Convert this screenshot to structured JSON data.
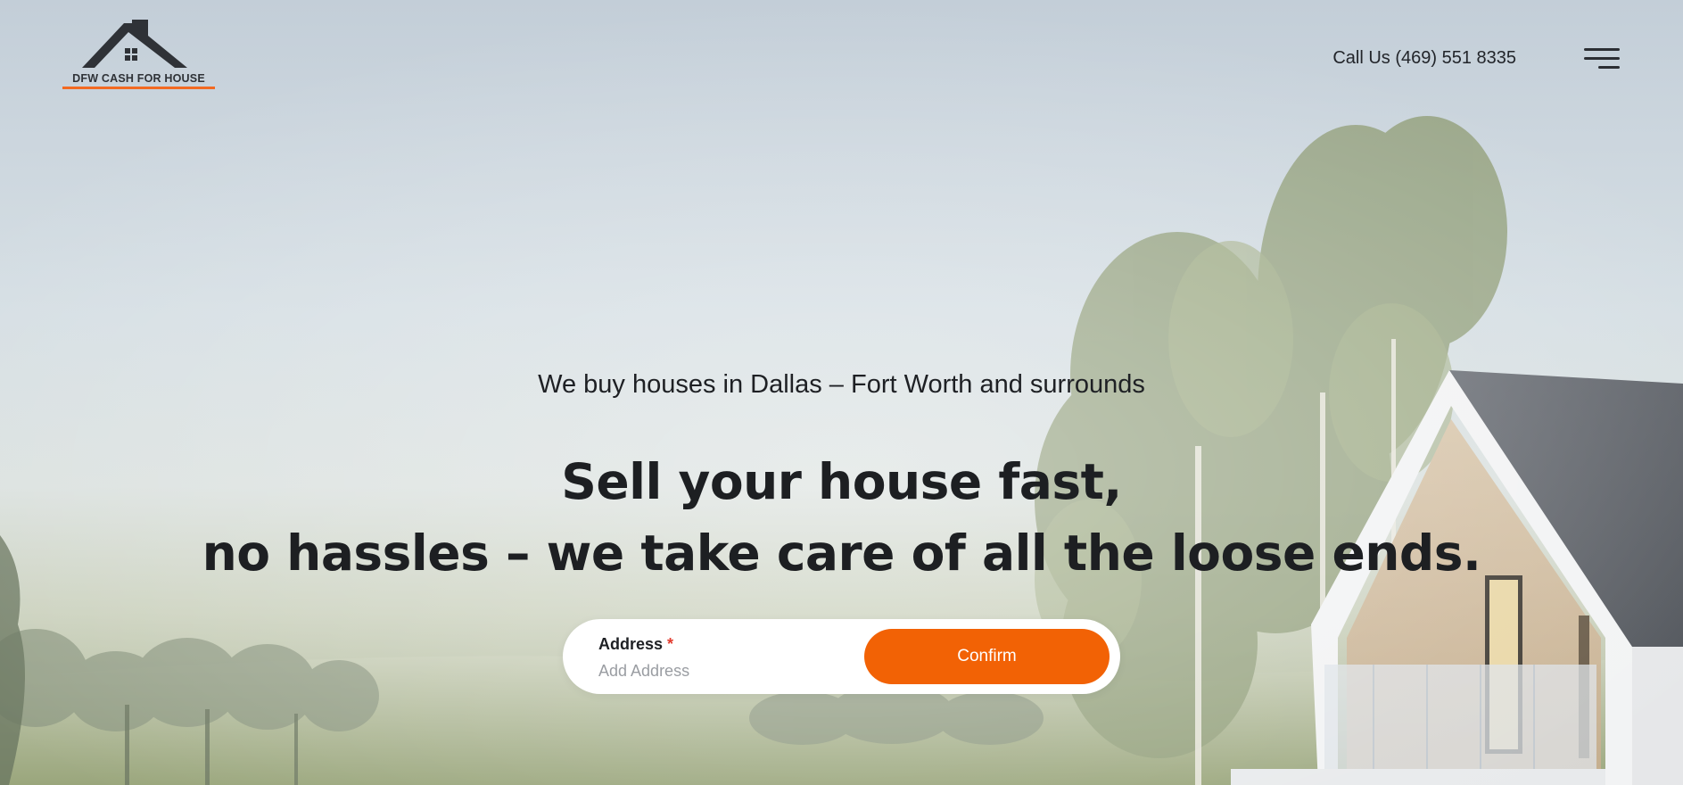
{
  "brand": {
    "logo_text": "DFW CASH FOR HOUSE",
    "accent_color": "#f26a22",
    "dark_color": "#2f3237"
  },
  "header": {
    "call_us": "Call Us (469) 551 8335",
    "menu_icon": "hamburger-menu-icon"
  },
  "hero": {
    "tagline": "We buy houses in Dallas – Fort Worth and surrounds",
    "headline_line1": "Sell your house fast,",
    "headline_line2": "no hassles – we take care of all the loose ends."
  },
  "form": {
    "address_label": "Address",
    "required_marker": "*",
    "address_placeholder": "Add Address",
    "address_value": "",
    "confirm_label": "Confirm",
    "button_color": "#f26205"
  }
}
